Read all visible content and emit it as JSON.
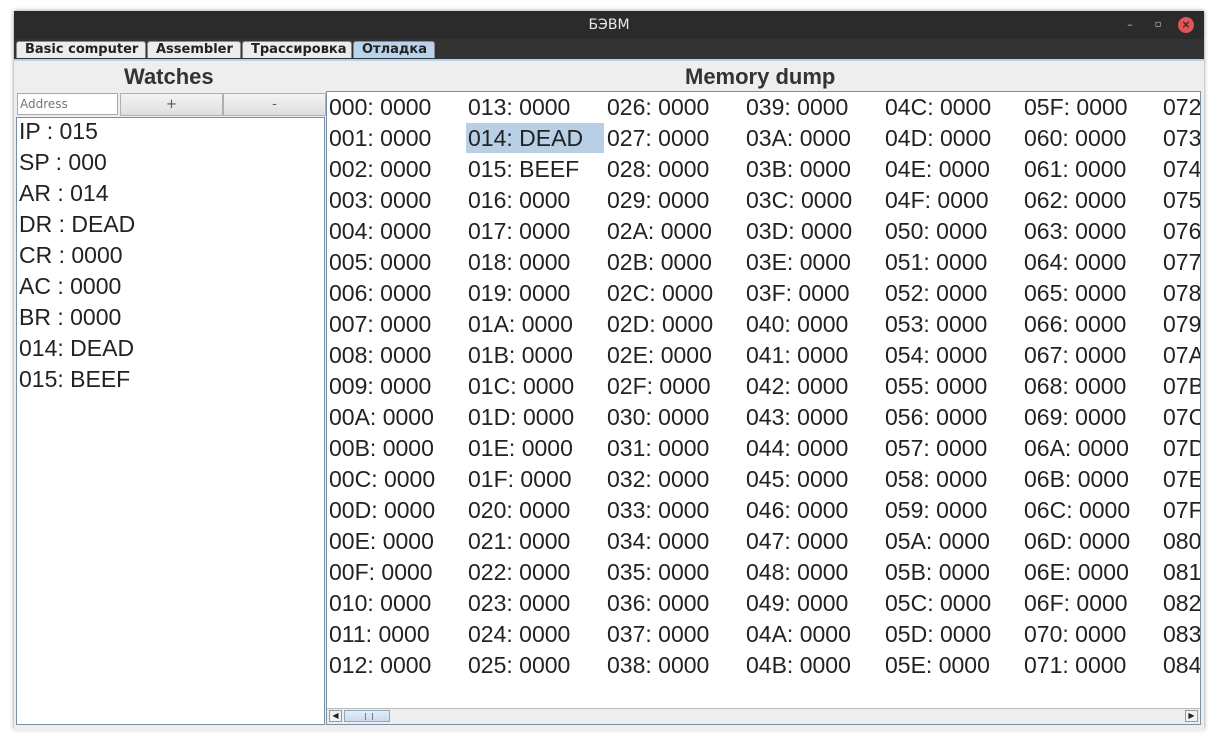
{
  "window": {
    "title": "БЭВМ"
  },
  "titlebar_buttons": {
    "minimize": "–",
    "maximize": "▫",
    "close": "×"
  },
  "tabs": [
    {
      "label": "Basic computer",
      "selected": false
    },
    {
      "label": "Assembler",
      "selected": false
    },
    {
      "label": "Трассировка",
      "selected": false
    },
    {
      "label": "Отладка",
      "selected": true
    }
  ],
  "watches": {
    "title": "Watches",
    "address_placeholder": "Address",
    "add_label": "+",
    "remove_label": "-",
    "items": [
      "IP : 015",
      "SP : 000",
      "AR : 014",
      "DR : DEAD",
      "CR : 0000",
      "AC : 0000",
      "BR : 0000",
      "014: DEAD",
      "015: BEEF"
    ]
  },
  "memory": {
    "title": "Memory dump",
    "selected_cell": "014: DEAD",
    "columns": [
      [
        "000: 0000",
        "001: 0000",
        "002: 0000",
        "003: 0000",
        "004: 0000",
        "005: 0000",
        "006: 0000",
        "007: 0000",
        "008: 0000",
        "009: 0000",
        "00A: 0000",
        "00B: 0000",
        "00C: 0000",
        "00D: 0000",
        "00E: 0000",
        "00F: 0000",
        "010: 0000",
        "011: 0000",
        "012: 0000"
      ],
      [
        "013: 0000",
        "014: DEAD",
        "015: BEEF",
        "016: 0000",
        "017: 0000",
        "018: 0000",
        "019: 0000",
        "01A: 0000",
        "01B: 0000",
        "01C: 0000",
        "01D: 0000",
        "01E: 0000",
        "01F: 0000",
        "020: 0000",
        "021: 0000",
        "022: 0000",
        "023: 0000",
        "024: 0000",
        "025: 0000"
      ],
      [
        "026: 0000",
        "027: 0000",
        "028: 0000",
        "029: 0000",
        "02A: 0000",
        "02B: 0000",
        "02C: 0000",
        "02D: 0000",
        "02E: 0000",
        "02F: 0000",
        "030: 0000",
        "031: 0000",
        "032: 0000",
        "033: 0000",
        "034: 0000",
        "035: 0000",
        "036: 0000",
        "037: 0000",
        "038: 0000"
      ],
      [
        "039: 0000",
        "03A: 0000",
        "03B: 0000",
        "03C: 0000",
        "03D: 0000",
        "03E: 0000",
        "03F: 0000",
        "040: 0000",
        "041: 0000",
        "042: 0000",
        "043: 0000",
        "044: 0000",
        "045: 0000",
        "046: 0000",
        "047: 0000",
        "048: 0000",
        "049: 0000",
        "04A: 0000",
        "04B: 0000"
      ],
      [
        "04C: 0000",
        "04D: 0000",
        "04E: 0000",
        "04F: 0000",
        "050: 0000",
        "051: 0000",
        "052: 0000",
        "053: 0000",
        "054: 0000",
        "055: 0000",
        "056: 0000",
        "057: 0000",
        "058: 0000",
        "059: 0000",
        "05A: 0000",
        "05B: 0000",
        "05C: 0000",
        "05D: 0000",
        "05E: 0000"
      ],
      [
        "05F: 0000",
        "060: 0000",
        "061: 0000",
        "062: 0000",
        "063: 0000",
        "064: 0000",
        "065: 0000",
        "066: 0000",
        "067: 0000",
        "068: 0000",
        "069: 0000",
        "06A: 0000",
        "06B: 0000",
        "06C: 0000",
        "06D: 0000",
        "06E: 0000",
        "06F: 0000",
        "070: 0000",
        "071: 0000"
      ],
      [
        "072",
        "073",
        "074",
        "075",
        "076",
        "077",
        "078",
        "079",
        "07A",
        "07B",
        "07C",
        "07D",
        "07E",
        "07F",
        "080",
        "081",
        "082",
        "083",
        "084"
      ]
    ]
  },
  "scrollbar": {
    "left_arrow": "◀",
    "right_arrow": "▶"
  },
  "colors": {
    "selection": "#b8cfe5",
    "selected_tab": "#b9d3ec",
    "titlebar": "#2b2b2b",
    "close_button": "#e45454"
  }
}
